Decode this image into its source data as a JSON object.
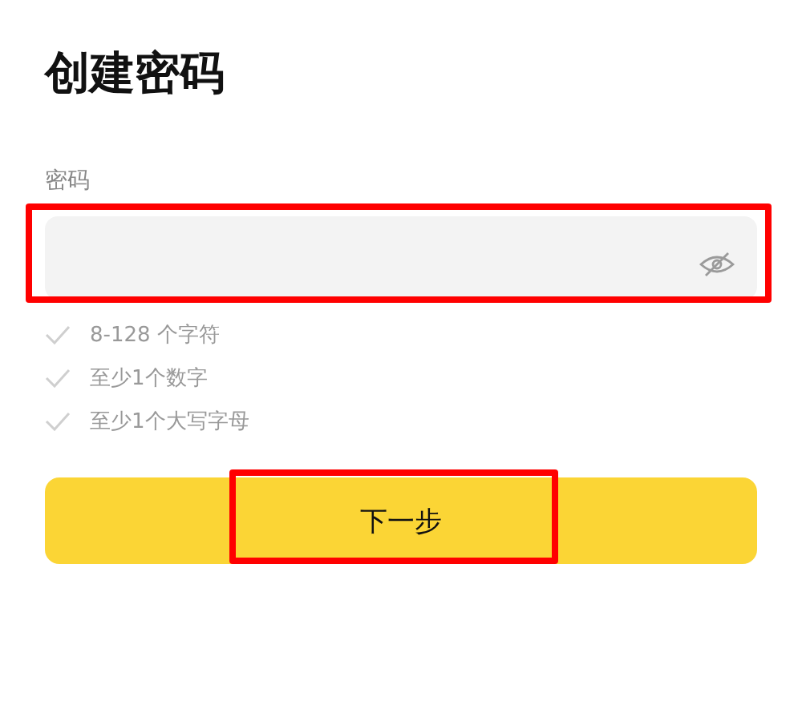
{
  "title": "创建密码",
  "password_field": {
    "label": "密码",
    "revealed": false
  },
  "requirements": [
    {
      "text": "8-128 个字符",
      "met": false
    },
    {
      "text": "至少1个数字",
      "met": false
    },
    {
      "text": "至少1个大写字母",
      "met": false
    }
  ],
  "next_button": {
    "label": "下一步"
  }
}
